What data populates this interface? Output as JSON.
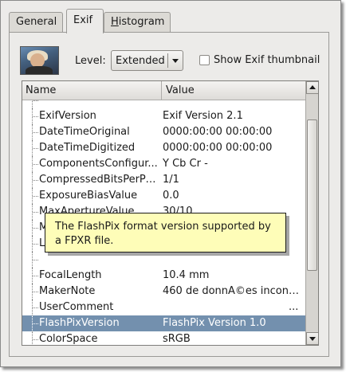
{
  "tabs": [
    {
      "label": "General"
    },
    {
      "label": "Exif"
    },
    {
      "label_first": "H",
      "label_rest": "istogram"
    }
  ],
  "thumbnail_icon": "photo-thumbnail",
  "level": {
    "label": "Level:",
    "value": "Extended"
  },
  "show_thumbnail": {
    "label": "Show Exif thumbnail",
    "checked": false
  },
  "table": {
    "headers": {
      "name": "Name",
      "value": "Value"
    },
    "rows": [
      {
        "name": "",
        "value": ""
      },
      {
        "name": "ExifVersion",
        "value": "Exif Version 2.1"
      },
      {
        "name": "DateTimeOriginal",
        "value": "0000:00:00 00:00:00"
      },
      {
        "name": "DateTimeDigitized",
        "value": "0000:00:00 00:00:00"
      },
      {
        "name": "ComponentsConfigur...",
        "value": "Y Cb Cr -"
      },
      {
        "name": "CompressedBitsPerPixel",
        "value": "1/1"
      },
      {
        "name": "ExposureBiasValue",
        "value": "0.0"
      },
      {
        "name": "MaxApertureValue",
        "value": "30/10"
      },
      {
        "name": "M",
        "value": ""
      },
      {
        "name": "L",
        "value": ""
      },
      {
        "name": "",
        "value": ""
      },
      {
        "name": "FocalLength",
        "value": "10.4 mm"
      },
      {
        "name": "MakerNote",
        "value": "460 de donnÃ©es inconn..."
      },
      {
        "name": "UserComment",
        "value": "..."
      },
      {
        "name": "FlashPixVersion",
        "value": "FlashPix Version 1.0"
      },
      {
        "name": "ColorSpace",
        "value": "sRGB"
      }
    ]
  },
  "tooltip": {
    "text": "The FlashPix format version supported by a FPXR file."
  },
  "colors": {
    "selection": "#7390ae",
    "tooltip_bg": "#fefdb8",
    "window_bg": "#ecebe9"
  }
}
